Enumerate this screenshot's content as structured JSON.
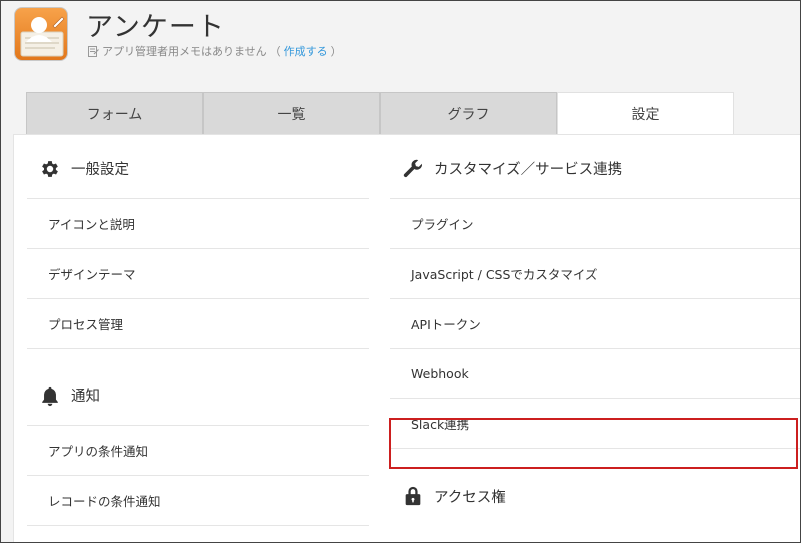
{
  "app": {
    "title": "アンケート",
    "memo_text": "アプリ管理者用メモはありません",
    "memo_open": "（",
    "memo_link": "作成する",
    "memo_close": "）",
    "icon_name": "app-survey-icon"
  },
  "tabs": [
    {
      "label": "フォーム",
      "active": false
    },
    {
      "label": "一覧",
      "active": false
    },
    {
      "label": "グラフ",
      "active": false
    },
    {
      "label": "設定",
      "active": true
    }
  ],
  "left_column": {
    "general": {
      "heading": "一般設定",
      "icon": "gear-icon",
      "items": [
        "アイコンと説明",
        "デザインテーマ",
        "プロセス管理"
      ]
    },
    "notify": {
      "heading": "通知",
      "icon": "bell-icon",
      "items": [
        "アプリの条件通知",
        "レコードの条件通知"
      ]
    }
  },
  "right_column": {
    "customize": {
      "heading": "カスタマイズ／サービス連携",
      "icon": "wrench-icon",
      "items": [
        "プラグイン",
        "JavaScript / CSSでカスタマイズ",
        "APIトークン",
        "Webhook",
        "Slack連携"
      ]
    },
    "access": {
      "heading": "アクセス権",
      "icon": "lock-icon"
    }
  },
  "colors": {
    "highlight": "#cc1f1f",
    "link": "#3498db",
    "tab_inactive": "#d9d9d9",
    "app_icon": "#e2771b"
  }
}
